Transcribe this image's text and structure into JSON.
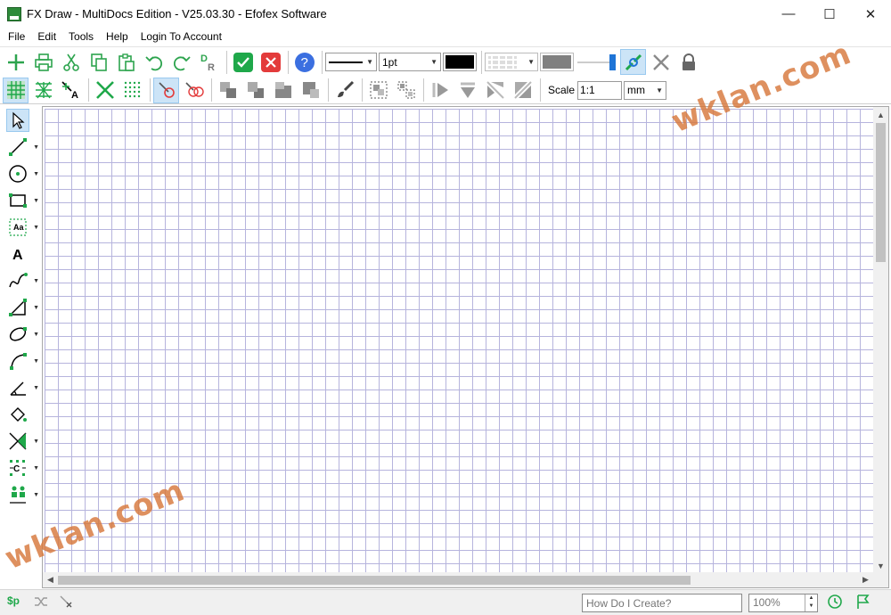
{
  "window": {
    "title": "FX Draw - MultiDocs Edition - V25.03.30 - Efofex Software",
    "minimize_glyph": "—",
    "maximize_glyph": "☐",
    "close_glyph": "✕"
  },
  "menu": {
    "items": [
      "File",
      "Edit",
      "Tools",
      "Help",
      "Login To Account"
    ]
  },
  "toolbar1": {
    "line_width": "1pt",
    "icons": [
      "new-icon",
      "print-icon",
      "cut-icon",
      "copy-icon",
      "paste-icon",
      "undo-icon",
      "redo-icon",
      "draw-reference-icon",
      "ok-icon",
      "cancel-icon",
      "help-icon"
    ]
  },
  "toolbar2": {
    "scale_label": "Scale",
    "scale_value": "1:1",
    "unit": "mm"
  },
  "status": {
    "how_placeholder": "How Do I Create?",
    "zoom": "100%",
    "left_icon_label": "$p"
  },
  "watermark": {
    "text": "wklan.com"
  },
  "colors": {
    "grid": "#b6b4dd",
    "accent_green": "#1fa84a",
    "accent_red": "#e33b3b",
    "accent_blue": "#3b6fe0",
    "selection": "#cce4f7"
  }
}
